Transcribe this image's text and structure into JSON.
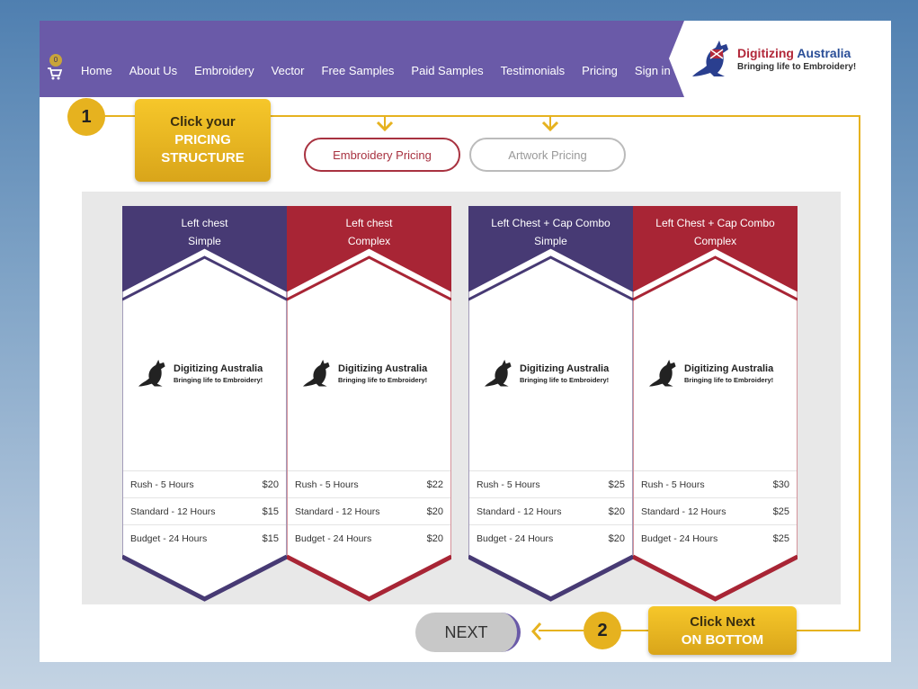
{
  "nav": {
    "cart_count": "0",
    "items": [
      "Home",
      "About Us",
      "Embroidery",
      "Vector",
      "Free Samples",
      "Paid Samples",
      "Testimonials",
      "Pricing",
      "Sign in"
    ]
  },
  "logo": {
    "title_prefix": "Digitizing ",
    "title_suffix": "Australia",
    "tagline": "Bringing life to Embroidery!"
  },
  "step1": {
    "number": "1",
    "line1": "Click your",
    "line2": "PRICING",
    "line3": "STRUCTURE"
  },
  "tabs": {
    "embroidery": "Embroidery Pricing",
    "artwork": "Artwork Pricing"
  },
  "cards": [
    {
      "title1": "Left chest",
      "title2": "Simple",
      "color": "#473a74",
      "rows": [
        {
          "label": "Rush - 5 Hours",
          "price": "$20"
        },
        {
          "label": "Standard - 12 Hours",
          "price": "$15"
        },
        {
          "label": "Budget - 24 Hours",
          "price": "$15"
        }
      ]
    },
    {
      "title1": "Left chest",
      "title2": "Complex",
      "color": "#a82535",
      "rows": [
        {
          "label": "Rush - 5 Hours",
          "price": "$22"
        },
        {
          "label": "Standard - 12 Hours",
          "price": "$20"
        },
        {
          "label": "Budget - 24 Hours",
          "price": "$20"
        }
      ]
    },
    {
      "title1": "Left Chest + Cap Combo",
      "title2": "Simple",
      "color": "#473a74",
      "rows": [
        {
          "label": "Rush - 5 Hours",
          "price": "$25"
        },
        {
          "label": "Standard - 12 Hours",
          "price": "$20"
        },
        {
          "label": "Budget - 24 Hours",
          "price": "$20"
        }
      ]
    },
    {
      "title1": "Left Chest + Cap Combo",
      "title2": "Complex",
      "color": "#a82535",
      "rows": [
        {
          "label": "Rush - 5 Hours",
          "price": "$30"
        },
        {
          "label": "Standard - 12 Hours",
          "price": "$25"
        },
        {
          "label": "Budget - 24 Hours",
          "price": "$25"
        }
      ]
    }
  ],
  "card_logo": {
    "title": "Digitizing Australia",
    "tagline": "Bringing life to Embroidery!"
  },
  "next": {
    "label": "NEXT"
  },
  "step2": {
    "number": "2",
    "line1": "Click Next",
    "line2": "ON BOTTOM"
  },
  "colors": {
    "nav_bg": "#6a5aa8",
    "accent": "#e6b21f",
    "purple": "#473a74",
    "red": "#a82535"
  }
}
